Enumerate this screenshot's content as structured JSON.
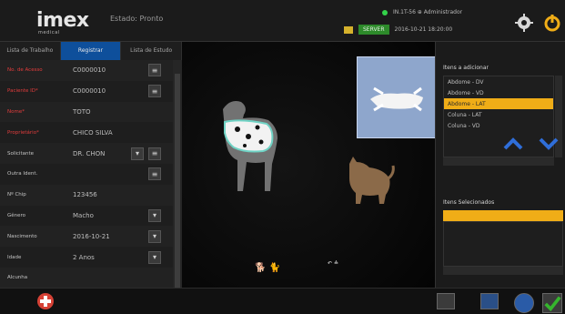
{
  "header": {
    "logo": "imex",
    "logo_sub": "medical",
    "study_status": "Estado: Pronto",
    "status_top": "IN.1T-56 ⊕ Administrador",
    "status_bottom": "2016-10-21 18:20:00",
    "chip": "SERVER"
  },
  "left_panel": {
    "tabs": [
      "Lista de Trabalho",
      "Registrar",
      "Lista de Estudo"
    ],
    "fields": [
      {
        "label": "No. de Acesso",
        "value": "C0000010",
        "required": true
      },
      {
        "label": "Paciente ID*",
        "value": "C0000010",
        "required": true
      },
      {
        "label": "Nome*",
        "value": "TOTO",
        "required": true
      },
      {
        "label": "Proprietário*",
        "value": "CHICO SILVA",
        "required": true
      },
      {
        "label": "Solicitante",
        "value": "DR. CHON",
        "required": false
      },
      {
        "label": "Outra Ident.",
        "value": "",
        "required": false
      },
      {
        "label": "Nº Chip",
        "value": "123456",
        "required": false
      },
      {
        "label": "Gênero",
        "value": "Macho",
        "required": false
      },
      {
        "label": "Nascimento",
        "value": "2016-10-21",
        "required": false
      },
      {
        "label": "Idade",
        "value": "2    Anos",
        "required": false
      },
      {
        "label": "Alcunha",
        "value": "",
        "required": false
      }
    ]
  },
  "right_panel": {
    "title_add": "Itens a adicionar",
    "items": [
      "Abdome - DV",
      "Abdome - VD",
      "Abdome - LAT",
      "Coluna - LAT",
      "Coluna - VD"
    ],
    "active_index": 2,
    "title_selected": "Itens Selecionados"
  },
  "canvas": {
    "bottom_icons": "🐕 🐈",
    "bottom_text": "↶ ≙"
  },
  "colors": {
    "accent_orange": "#f0ad17",
    "accent_blue": "#0e4f9b",
    "label_red": "#e33c3c"
  }
}
